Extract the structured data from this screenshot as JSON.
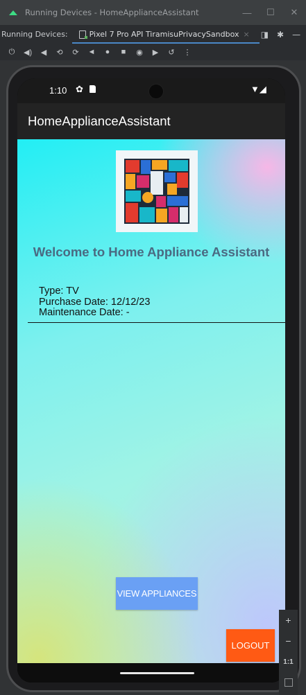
{
  "window": {
    "title": "Running Devices - HomeApplianceAssistant",
    "minimize": "—",
    "maximize": "☐",
    "close": "✕"
  },
  "tabbar": {
    "label": "Running Devices:",
    "tab": "Pixel 7 Pro API TiramisuPrivacySandbox",
    "tab_close": "×",
    "more": "—"
  },
  "toolbar": {
    "icons": [
      "power-icon",
      "volume-up-icon",
      "volume-down-icon",
      "rotate-left-icon",
      "rotate-right-icon",
      "back-icon",
      "home-icon",
      "overview-icon",
      "screenshot-icon",
      "screen-record-icon",
      "snapshot-icon",
      "more-icon"
    ]
  },
  "statusbar": {
    "time": "1:10"
  },
  "app": {
    "title": "HomeApplianceAssistant",
    "welcome": "Welcome to Home Appliance Assistant",
    "type_line": "Type: TV",
    "purchase_line": "Purchase Date: 12/12/23",
    "maintenance_line": "Maintenance Date: -",
    "view_button": "VIEW APPLIANCES",
    "logout_button": "LOGOUT"
  },
  "zoom": {
    "plus": "+",
    "minus": "−",
    "one_to_one": "1:1"
  },
  "colors": {
    "view_button": "#6aa0f4",
    "logout_button": "#ff5a14",
    "welcome_text": "#4a6a82",
    "tab_underline": "#4a88c7"
  }
}
